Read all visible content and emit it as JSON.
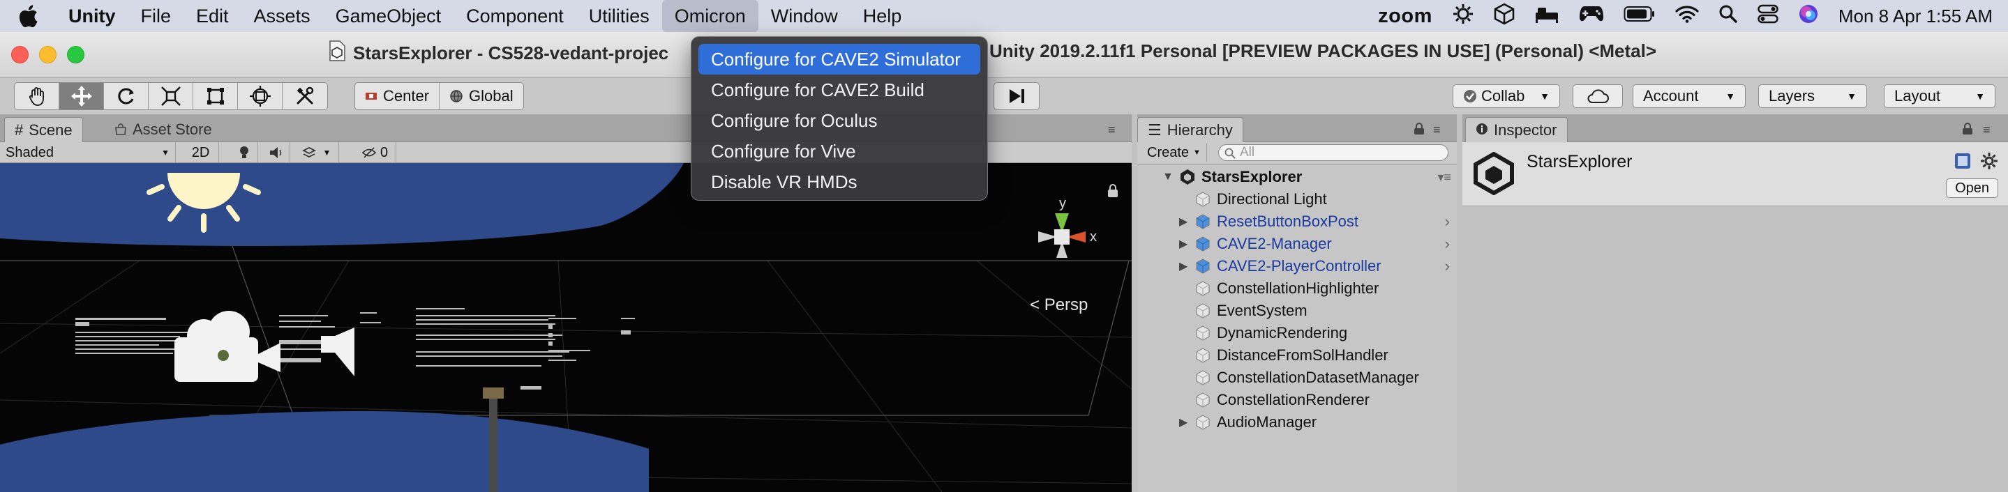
{
  "menubar": {
    "app_name": "Unity",
    "items": [
      "File",
      "Edit",
      "Assets",
      "GameObject",
      "Component",
      "Utilities",
      "Omicron",
      "Window",
      "Help"
    ],
    "open_menu": "Omicron",
    "zoom_label": "zoom",
    "clock": "Mon 8 Apr  1:55 AM"
  },
  "window": {
    "title_left": "StarsExplorer - CS528-vedant-projec",
    "title_right": "Unity 2019.2.11f1 Personal [PREVIEW PACKAGES IN USE] (Personal) <Metal>"
  },
  "toolbar": {
    "pivot": "Center",
    "space": "Global",
    "collab": "Collab",
    "account": "Account",
    "layers": "Layers",
    "layout": "Layout"
  },
  "scene": {
    "tab_scene": "Scene",
    "tab_asset_store": "Asset Store",
    "shading": "Shaded",
    "mode_2d": "2D",
    "hidden_count": "0",
    "persp": "Persp",
    "gizmo_y": "y",
    "gizmo_x": "x"
  },
  "hierarchy": {
    "tab": "Hierarchy",
    "create": "Create",
    "search_placeholder": "All",
    "root": "StarsExplorer",
    "items": [
      {
        "label": "Directional Light",
        "prefab": false,
        "expandable": false,
        "more": false
      },
      {
        "label": "ResetButtonBoxPost",
        "prefab": true,
        "expandable": true,
        "more": true
      },
      {
        "label": "CAVE2-Manager",
        "prefab": true,
        "expandable": true,
        "more": true
      },
      {
        "label": "CAVE2-PlayerController",
        "prefab": true,
        "expandable": true,
        "more": true
      },
      {
        "label": "ConstellationHighlighter",
        "prefab": false,
        "expandable": false,
        "more": false
      },
      {
        "label": "EventSystem",
        "prefab": false,
        "expandable": false,
        "more": false
      },
      {
        "label": "DynamicRendering",
        "prefab": false,
        "expandable": false,
        "more": false
      },
      {
        "label": "DistanceFromSolHandler",
        "prefab": false,
        "expandable": false,
        "more": false
      },
      {
        "label": "ConstellationDatasetManager",
        "prefab": false,
        "expandable": false,
        "more": false
      },
      {
        "label": "ConstellationRenderer",
        "prefab": false,
        "expandable": false,
        "more": false
      },
      {
        "label": "AudioManager",
        "prefab": false,
        "expandable": true,
        "more": false
      }
    ]
  },
  "inspector": {
    "tab": "Inspector",
    "object_name": "StarsExplorer",
    "open_button": "Open"
  },
  "omicron_menu": {
    "items": [
      "Configure for CAVE2 Simulator",
      "Configure for CAVE2 Build",
      "Configure for Oculus",
      "Configure for Vive",
      "Disable VR HMDs"
    ],
    "selected_index": 0
  },
  "colors": {
    "menu_highlight": "#2f6ed9",
    "prefab_text": "#1a3aa0",
    "scene_background": "#050505",
    "scene_plane": "#2f4a8a"
  }
}
